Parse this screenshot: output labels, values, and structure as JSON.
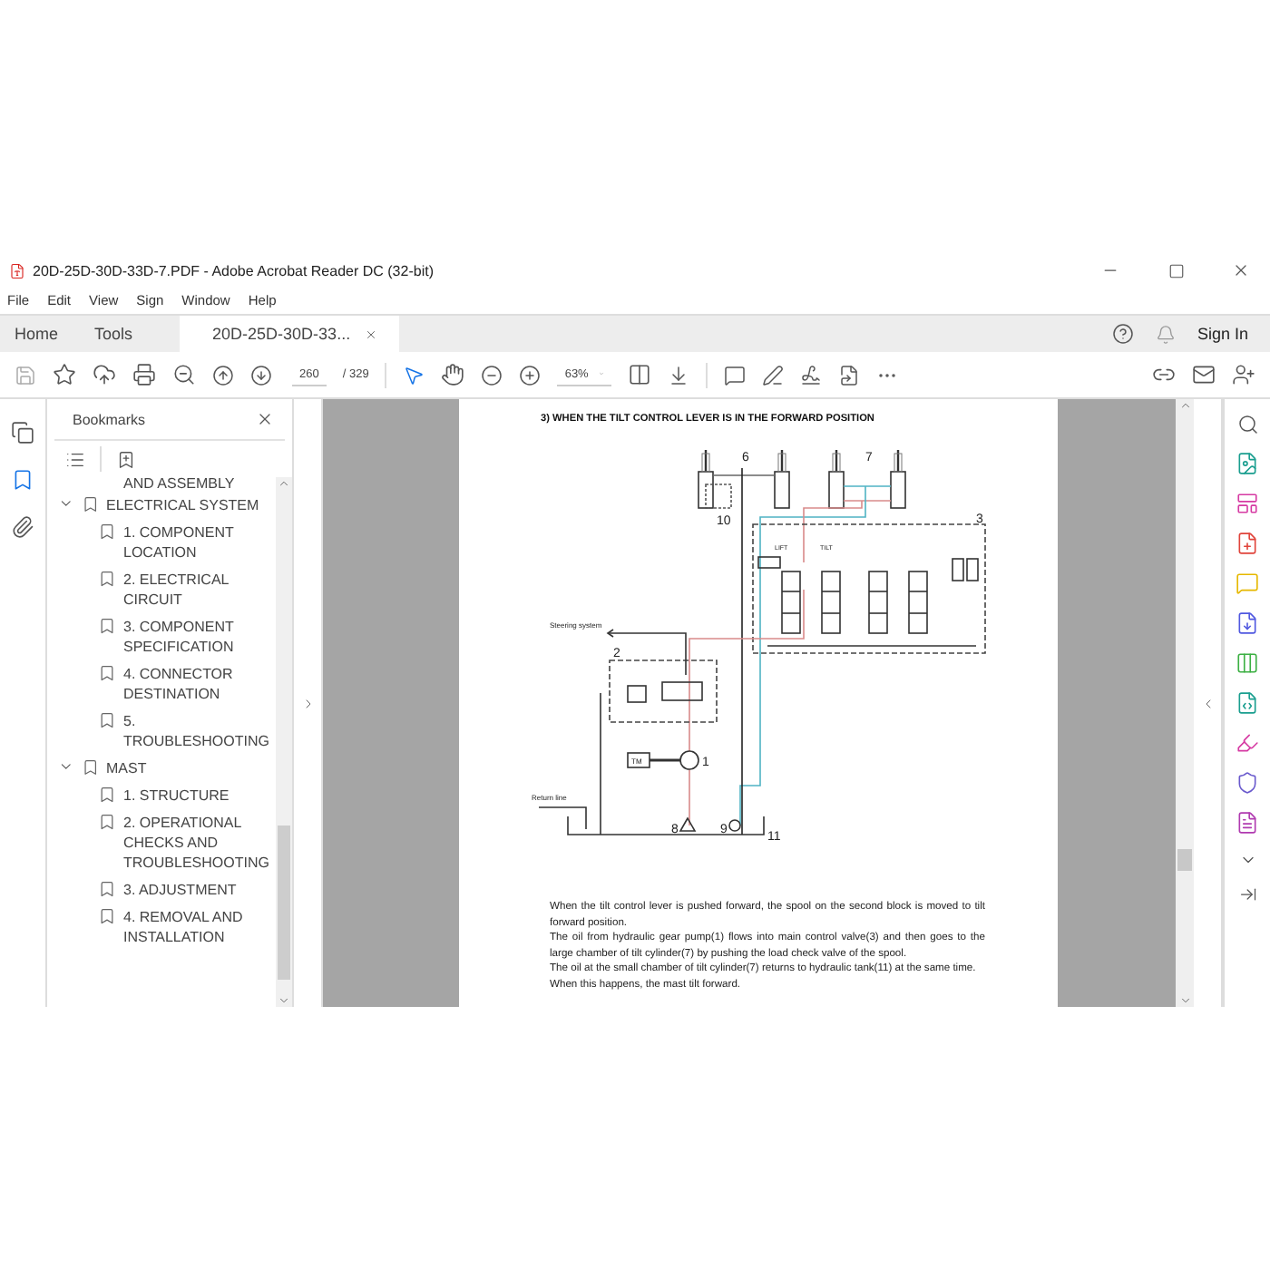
{
  "window": {
    "title": "20D-25D-30D-33D-7.PDF - Adobe Acrobat Reader DC (32-bit)"
  },
  "menu": [
    "File",
    "Edit",
    "View",
    "Sign",
    "Window",
    "Help"
  ],
  "tabs": [
    {
      "label": "Home",
      "selected": false
    },
    {
      "label": "Tools",
      "selected": false
    },
    {
      "label": "20D-25D-30D-33...",
      "selected": true
    }
  ],
  "account": {
    "sign_in": "Sign In"
  },
  "toolbar": {
    "page_current": "260",
    "page_total": "/ 329",
    "zoom": "63%"
  },
  "left_rail": [
    {
      "kind": "pages",
      "selected": false
    },
    {
      "kind": "bookmarks",
      "selected": true
    },
    {
      "kind": "attachments",
      "selected": false
    }
  ],
  "bookmarks": {
    "title": "Bookmarks",
    "cut_text": "AND ASSEMBLY",
    "items": [
      {
        "label": "ELECTRICAL SYSTEM",
        "expanded": true,
        "children": [
          {
            "label": "1. COMPONENT LOCATION"
          },
          {
            "label": "2. ELECTRICAL CIRCUIT"
          },
          {
            "label": "3. COMPONENT SPECIFICATION"
          },
          {
            "label": "4. CONNECTOR DESTINATION"
          },
          {
            "label": "5. TROUBLESHOOTING"
          }
        ]
      },
      {
        "label": "MAST",
        "expanded": true,
        "children": [
          {
            "label": "1. STRUCTURE"
          },
          {
            "label": "2. OPERATIONAL CHECKS AND TROUBLESHOOTING"
          },
          {
            "label": "3. ADJUSTMENT"
          },
          {
            "label": "4. REMOVAL AND INSTALLATION"
          }
        ]
      }
    ]
  },
  "document": {
    "heading": "3) WHEN THE TILT CONTROL LEVER IS IN THE FORWARD POSITION",
    "schematic_labels": [
      "6",
      "7",
      "10",
      "3",
      "2",
      "Steering system",
      "LIFT",
      "TILT",
      "TM",
      "1",
      "Return line",
      "8",
      "9",
      "11"
    ],
    "paragraphs": [
      "When the tilt control lever is pushed forward, the spool on the second block is moved to tilt forward position.",
      "The oil from hydraulic gear pump(1) flows into main control valve(3) and then goes to the large chamber of tilt cylinder(7) by pushing the load check valve of the spool.",
      "The oil at the small chamber of tilt cylinder(7) returns to hydraulic tank(11) at the same time.",
      "When this happens, the mast tilt forward."
    ]
  }
}
